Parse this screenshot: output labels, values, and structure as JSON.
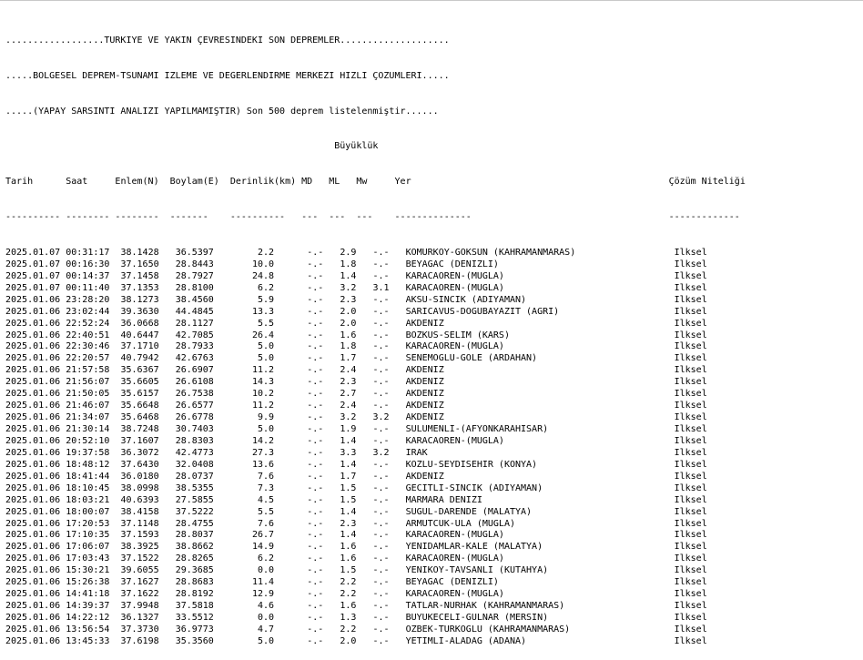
{
  "header": {
    "line1": "..................TÜRKİYE VE YAKIN ÇEVRESİNDEKİ SON DEPREMLER....................",
    "line2": ".....BÖLGESEL DEPREM-TSUNAMİ İZLEME VE DEĞERLENDİRME MERKEZİ HIZLI ÇÖZÜMLERİ.....",
    "line3": ".....(YAPAY SARSINTI ANALİZİ YAPILMAMIŞTIR) Son 500 deprem listelenmiştir......"
  },
  "table": {
    "magnitude_group_label": "Büyüklük",
    "columns": {
      "date": "Tarih",
      "time": "Saat",
      "lat": "Enlem(N)",
      "lon": "Boylam(E)",
      "depth": "Derinlik(km)",
      "md": "MD",
      "ml": "ML",
      "mw": "Mw",
      "place": "Yer",
      "quality": "Çözüm Niteliği"
    },
    "separator": {
      "date": "----------",
      "time": "--------",
      "lat": "--------",
      "lon": "-------",
      "depth": "----------",
      "md": "---",
      "ml": "---",
      "mw": "---",
      "place": "--------------",
      "quality": "-------------"
    },
    "rows": [
      {
        "date": "2025.01.07",
        "time": "00:31:17",
        "lat": "38.1428",
        "lon": "36.5397",
        "depth": "2.2",
        "md": "-.-",
        "ml": "2.9",
        "mw": "-.-",
        "place": "KOMURKOY-GOKSUN (KAHRAMANMARAS)",
        "quality": "İlksel"
      },
      {
        "date": "2025.01.07",
        "time": "00:16:30",
        "lat": "37.1650",
        "lon": "28.8443",
        "depth": "10.0",
        "md": "-.-",
        "ml": "1.8",
        "mw": "-.-",
        "place": "BEYAGAC (DENIZLI)",
        "quality": "İlksel"
      },
      {
        "date": "2025.01.07",
        "time": "00:14:37",
        "lat": "37.1458",
        "lon": "28.7927",
        "depth": "24.8",
        "md": "-.-",
        "ml": "1.4",
        "mw": "-.-",
        "place": "KARACAOREN-(MUGLA)",
        "quality": "İlksel"
      },
      {
        "date": "2025.01.07",
        "time": "00:11:40",
        "lat": "37.1353",
        "lon": "28.8100",
        "depth": "6.2",
        "md": "-.-",
        "ml": "3.2",
        "mw": "3.1",
        "place": "KARACAOREN-(MUGLA)",
        "quality": "İlksel"
      },
      {
        "date": "2025.01.06",
        "time": "23:28:20",
        "lat": "38.1273",
        "lon": "38.4560",
        "depth": "5.9",
        "md": "-.-",
        "ml": "2.3",
        "mw": "-.-",
        "place": "AKSU-SINCIK (ADIYAMAN)",
        "quality": "İlksel"
      },
      {
        "date": "2025.01.06",
        "time": "23:02:44",
        "lat": "39.3630",
        "lon": "44.4845",
        "depth": "13.3",
        "md": "-.-",
        "ml": "2.0",
        "mw": "-.-",
        "place": "SARICAVUS-DOGUBAYAZIT (AGRI)",
        "quality": "İlksel"
      },
      {
        "date": "2025.01.06",
        "time": "22:52:24",
        "lat": "36.0668",
        "lon": "28.1127",
        "depth": "5.5",
        "md": "-.-",
        "ml": "2.0",
        "mw": "-.-",
        "place": "AKDENIZ",
        "quality": "İlksel"
      },
      {
        "date": "2025.01.06",
        "time": "22:40:51",
        "lat": "40.6447",
        "lon": "42.7085",
        "depth": "26.4",
        "md": "-.-",
        "ml": "1.6",
        "mw": "-.-",
        "place": "BOZKUS-SELIM (KARS)",
        "quality": "İlksel"
      },
      {
        "date": "2025.01.06",
        "time": "22:30:46",
        "lat": "37.1710",
        "lon": "28.7933",
        "depth": "5.0",
        "md": "-.-",
        "ml": "1.8",
        "mw": "-.-",
        "place": "KARACAOREN-(MUGLA)",
        "quality": "İlksel"
      },
      {
        "date": "2025.01.06",
        "time": "22:20:57",
        "lat": "40.7942",
        "lon": "42.6763",
        "depth": "5.0",
        "md": "-.-",
        "ml": "1.7",
        "mw": "-.-",
        "place": "SENEMOGLU-GOLE (ARDAHAN)",
        "quality": "İlksel"
      },
      {
        "date": "2025.01.06",
        "time": "21:57:58",
        "lat": "35.6367",
        "lon": "26.6907",
        "depth": "11.2",
        "md": "-.-",
        "ml": "2.4",
        "mw": "-.-",
        "place": "AKDENIZ",
        "quality": "İlksel"
      },
      {
        "date": "2025.01.06",
        "time": "21:56:07",
        "lat": "35.6605",
        "lon": "26.6108",
        "depth": "14.3",
        "md": "-.-",
        "ml": "2.3",
        "mw": "-.-",
        "place": "AKDENIZ",
        "quality": "İlksel"
      },
      {
        "date": "2025.01.06",
        "time": "21:50:05",
        "lat": "35.6157",
        "lon": "26.7538",
        "depth": "10.2",
        "md": "-.-",
        "ml": "2.7",
        "mw": "-.-",
        "place": "AKDENIZ",
        "quality": "İlksel"
      },
      {
        "date": "2025.01.06",
        "time": "21:46:07",
        "lat": "35.6648",
        "lon": "26.6577",
        "depth": "11.2",
        "md": "-.-",
        "ml": "2.4",
        "mw": "-.-",
        "place": "AKDENIZ",
        "quality": "İlksel"
      },
      {
        "date": "2025.01.06",
        "time": "21:34:07",
        "lat": "35.6468",
        "lon": "26.6778",
        "depth": "9.9",
        "md": "-.-",
        "ml": "3.2",
        "mw": "3.2",
        "place": "AKDENIZ",
        "quality": "İlksel"
      },
      {
        "date": "2025.01.06",
        "time": "21:30:14",
        "lat": "38.7248",
        "lon": "30.7403",
        "depth": "5.0",
        "md": "-.-",
        "ml": "1.9",
        "mw": "-.-",
        "place": "SULUMENLI-(AFYONKARAHISAR)",
        "quality": "İlksel"
      },
      {
        "date": "2025.01.06",
        "time": "20:52:10",
        "lat": "37.1607",
        "lon": "28.8303",
        "depth": "14.2",
        "md": "-.-",
        "ml": "1.4",
        "mw": "-.-",
        "place": "KARACAOREN-(MUGLA)",
        "quality": "İlksel"
      },
      {
        "date": "2025.01.06",
        "time": "19:37:58",
        "lat": "36.3072",
        "lon": "42.4773",
        "depth": "27.3",
        "md": "-.-",
        "ml": "3.3",
        "mw": "3.2",
        "place": "IRAK",
        "quality": "İlksel"
      },
      {
        "date": "2025.01.06",
        "time": "18:48:12",
        "lat": "37.6430",
        "lon": "32.0408",
        "depth": "13.6",
        "md": "-.-",
        "ml": "1.4",
        "mw": "-.-",
        "place": "KOZLU-SEYDISEHIR (KONYA)",
        "quality": "İlksel"
      },
      {
        "date": "2025.01.06",
        "time": "18:41:44",
        "lat": "36.0180",
        "lon": "28.0737",
        "depth": "7.6",
        "md": "-.-",
        "ml": "1.7",
        "mw": "-.-",
        "place": "AKDENIZ",
        "quality": "İlksel"
      },
      {
        "date": "2025.01.06",
        "time": "18:10:45",
        "lat": "38.0998",
        "lon": "38.5355",
        "depth": "7.3",
        "md": "-.-",
        "ml": "1.5",
        "mw": "-.-",
        "place": "GECITLI-SINCIK (ADIYAMAN)",
        "quality": "İlksel"
      },
      {
        "date": "2025.01.06",
        "time": "18:03:21",
        "lat": "40.6393",
        "lon": "27.5855",
        "depth": "4.5",
        "md": "-.-",
        "ml": "1.5",
        "mw": "-.-",
        "place": "MARMARA DENIZI",
        "quality": "İlksel"
      },
      {
        "date": "2025.01.06",
        "time": "18:00:07",
        "lat": "38.4158",
        "lon": "37.5222",
        "depth": "5.5",
        "md": "-.-",
        "ml": "1.4",
        "mw": "-.-",
        "place": "SUGUL-DARENDE (MALATYA)",
        "quality": "İlksel"
      },
      {
        "date": "2025.01.06",
        "time": "17:20:53",
        "lat": "37.1148",
        "lon": "28.4755",
        "depth": "7.6",
        "md": "-.-",
        "ml": "2.3",
        "mw": "-.-",
        "place": "ARMUTCUK-ULA (MUGLA)",
        "quality": "İlksel"
      },
      {
        "date": "2025.01.06",
        "time": "17:10:35",
        "lat": "37.1593",
        "lon": "28.8037",
        "depth": "26.7",
        "md": "-.-",
        "ml": "1.4",
        "mw": "-.-",
        "place": "KARACAOREN-(MUGLA)",
        "quality": "İlksel"
      },
      {
        "date": "2025.01.06",
        "time": "17:06:07",
        "lat": "38.3925",
        "lon": "38.8662",
        "depth": "14.9",
        "md": "-.-",
        "ml": "1.6",
        "mw": "-.-",
        "place": "YENIDAMLAR-KALE (MALATYA)",
        "quality": "İlksel"
      },
      {
        "date": "2025.01.06",
        "time": "17:03:43",
        "lat": "37.1522",
        "lon": "28.8265",
        "depth": "6.2",
        "md": "-.-",
        "ml": "1.6",
        "mw": "-.-",
        "place": "KARACAOREN-(MUGLA)",
        "quality": "İlksel"
      },
      {
        "date": "2025.01.06",
        "time": "15:30:21",
        "lat": "39.6055",
        "lon": "29.3685",
        "depth": "0.0",
        "md": "-.-",
        "ml": "1.5",
        "mw": "-.-",
        "place": "YENIKOY-TAVSANLI (KUTAHYA)",
        "quality": "İlksel"
      },
      {
        "date": "2025.01.06",
        "time": "15:26:38",
        "lat": "37.1627",
        "lon": "28.8683",
        "depth": "11.4",
        "md": "-.-",
        "ml": "2.2",
        "mw": "-.-",
        "place": "BEYAGAC (DENIZLI)",
        "quality": "İlksel"
      },
      {
        "date": "2025.01.06",
        "time": "14:41:18",
        "lat": "37.1622",
        "lon": "28.8192",
        "depth": "12.9",
        "md": "-.-",
        "ml": "2.2",
        "mw": "-.-",
        "place": "KARACAOREN-(MUGLA)",
        "quality": "İlksel"
      },
      {
        "date": "2025.01.06",
        "time": "14:39:37",
        "lat": "37.9948",
        "lon": "37.5818",
        "depth": "4.6",
        "md": "-.-",
        "ml": "1.6",
        "mw": "-.-",
        "place": "TATLAR-NURHAK (KAHRAMANMARAS)",
        "quality": "İlksel"
      },
      {
        "date": "2025.01.06",
        "time": "14:22:12",
        "lat": "36.1327",
        "lon": "33.5512",
        "depth": "0.0",
        "md": "-.-",
        "ml": "1.3",
        "mw": "-.-",
        "place": "BUYUKECELI-GULNAR (MERSIN)",
        "quality": "İlksel"
      },
      {
        "date": "2025.01.06",
        "time": "13:56:54",
        "lat": "37.3730",
        "lon": "36.9773",
        "depth": "4.7",
        "md": "-.-",
        "ml": "2.2",
        "mw": "-.-",
        "place": "OZBEK-TURKOGLU (KAHRAMANMARAS)",
        "quality": "İlksel"
      },
      {
        "date": "2025.01.06",
        "time": "13:45:33",
        "lat": "37.6198",
        "lon": "35.3560",
        "depth": "5.0",
        "md": "-.-",
        "ml": "2.0",
        "mw": "-.-",
        "place": "YETIMLI-ALADAG (ADANA)",
        "quality": "İlksel"
      }
    ]
  }
}
